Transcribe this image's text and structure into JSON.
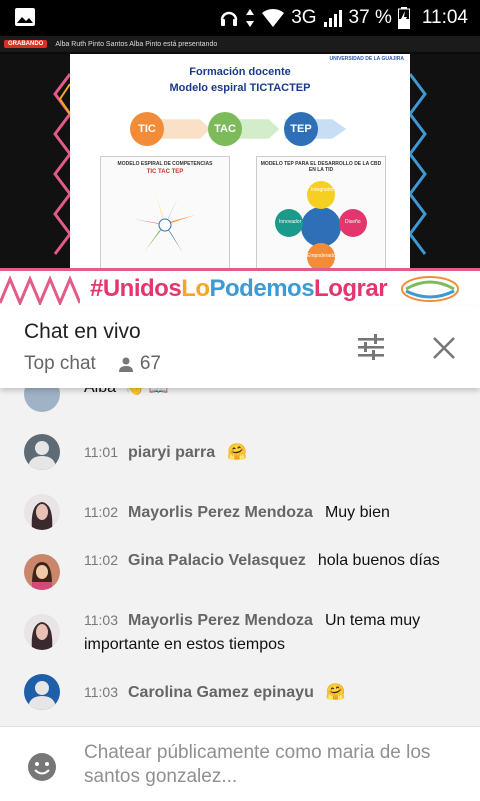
{
  "status_bar": {
    "network": "3G",
    "battery": "37 %",
    "time": "11:04",
    "icons": [
      "image-icon",
      "headphones-icon",
      "data-arrows-icon",
      "wifi-icon",
      "signal-icon",
      "battery-charging-icon"
    ]
  },
  "video": {
    "recording_label": "GRABANDO",
    "presenter_text": "Alba Ruth Pinto Santos Alba Pinto está presentando",
    "slide": {
      "title": "Formación docente",
      "subtitle": "Modelo espiral TICTACTEP",
      "stages": [
        "TIC",
        "TAC",
        "TEP"
      ],
      "left_box_caption": "MODELO ESPIRAL DE COMPETENCIAS",
      "left_box_stages": "TIC TAC TEP",
      "right_box_caption": "MODELO TEP PARA EL DESARROLLO DE LA CBD EN LA TID",
      "right_box_labels": [
        "Integrador",
        "Diseño",
        "Empoderado",
        "Innovador"
      ]
    },
    "university_logo_text": "UNIVERSIDAD DE LA GUAJIRA",
    "banner": {
      "part1": "#Unidos",
      "part2": "Lo",
      "part3": "Podemos",
      "part4": "Lograr"
    }
  },
  "chat_header": {
    "title": "Chat en vivo",
    "mode": "Top chat",
    "viewer_count": "67",
    "colors": {
      "accent": "#e2366d"
    }
  },
  "messages": [
    {
      "time": "",
      "author": "",
      "text": "Alba",
      "emoji": "👋 📖",
      "partial": true
    },
    {
      "time": "11:01",
      "author": "piaryi parra",
      "text": "",
      "emoji": "🤗"
    },
    {
      "time": "11:02",
      "author": "Mayorlis Perez Mendoza",
      "text": "Muy bien",
      "emoji": ""
    },
    {
      "time": "11:02",
      "author": "Gina Palacio Velasquez",
      "text": "hola buenos días",
      "emoji": ""
    },
    {
      "time": "11:03",
      "author": "Mayorlis Perez Mendoza",
      "text": "Un tema muy importante en estos tiempos",
      "emoji": ""
    },
    {
      "time": "11:03",
      "author": "Carolina Gamez epinayu",
      "text": "",
      "emoji": "🤗"
    }
  ],
  "input": {
    "placeholder": "Chatear públicamente como maria de los santos gonzalez..."
  }
}
